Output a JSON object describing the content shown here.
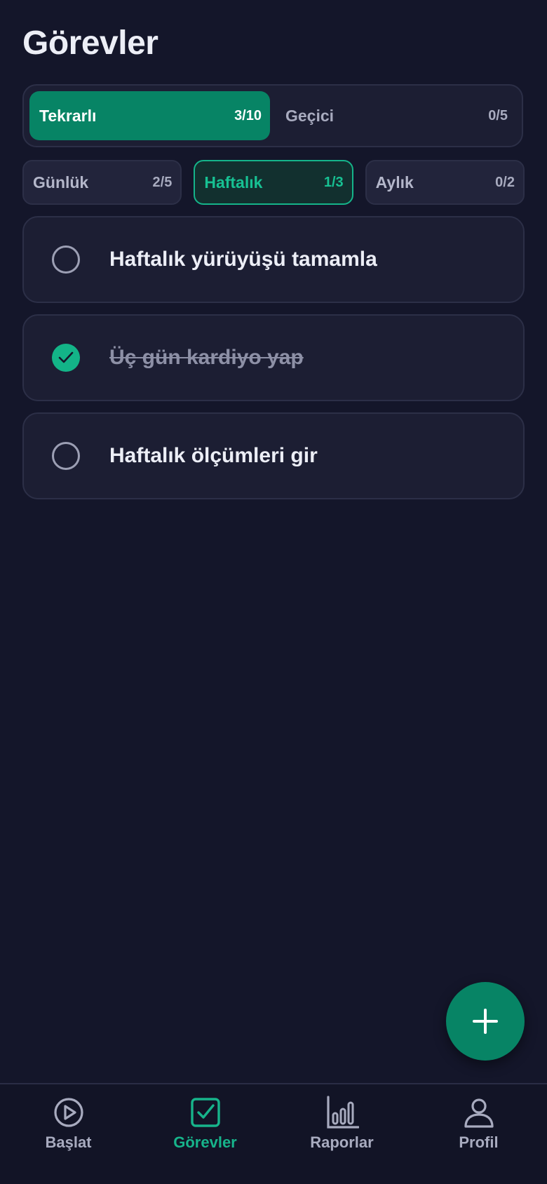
{
  "page": {
    "title": "Görevler"
  },
  "segments": [
    {
      "label": "Tekrarlı",
      "count": "3/10",
      "active": true
    },
    {
      "label": "Geçici",
      "count": "0/5",
      "active": false
    }
  ],
  "periods": [
    {
      "label": "Günlük",
      "count": "2/5",
      "active": false
    },
    {
      "label": "Haftalık",
      "count": "1/3",
      "active": true
    },
    {
      "label": "Aylık",
      "count": "0/2",
      "active": false
    }
  ],
  "tasks": [
    {
      "text": "Haftalık yürüyüşü tamamla",
      "done": false
    },
    {
      "text": "Üç gün kardiyo yap",
      "done": true
    },
    {
      "text": "Haftalık ölçümleri gir",
      "done": false
    }
  ],
  "fab": {
    "icon": "plus-icon"
  },
  "nav": [
    {
      "label": "Başlat",
      "icon": "play-circle-icon",
      "active": false
    },
    {
      "label": "Görevler",
      "icon": "checkbox-icon",
      "active": true
    },
    {
      "label": "Raporlar",
      "icon": "bar-chart-icon",
      "active": false
    },
    {
      "label": "Profil",
      "icon": "user-icon",
      "active": false
    }
  ],
  "colors": {
    "background": "#14162a",
    "accent": "#078465",
    "accent_light": "#17c193",
    "card": "#1c1e33",
    "muted_text": "#a8abbf"
  }
}
